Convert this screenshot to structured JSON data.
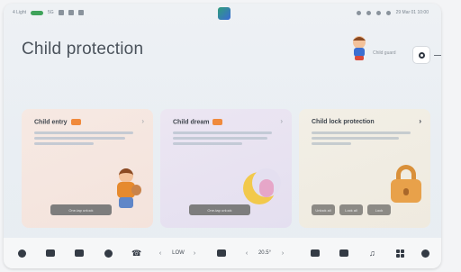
{
  "status_bar": {
    "left_text": "4 Light",
    "signal_text": "5G",
    "right_text": "29 Mar 01 10:00"
  },
  "header": {
    "title": "Child protection",
    "profile_label": "Child guard"
  },
  "cards": {
    "child_entry": {
      "title": "Child entry",
      "chevron": "›",
      "action_label": "One-tap unlock"
    },
    "child_dream": {
      "title": "Child dream",
      "chevron": "›",
      "action_label": "One-tap unlock"
    },
    "child_lock": {
      "title": "Child lock protection",
      "chevron": "›",
      "actions": [
        "Unlock all",
        "Lock all",
        "Lock"
      ]
    }
  },
  "dock": {
    "fan_level": "LOW",
    "temperature": "20.5°",
    "left_chevron": "‹",
    "right_chevron": "›"
  },
  "colors": {
    "accent_orange": "#f08a3c",
    "title_text": "#4a525b",
    "card_entry_bg": "#f6e9e3",
    "card_dream_bg": "#ece6f2",
    "card_lock_bg": "#f2efe6",
    "button_gray": "#7d7d7d"
  },
  "icons": {
    "settings": "gear-icon",
    "dock": [
      "car-icon",
      "seat-icon",
      "window-icon",
      "fan-icon",
      "phone-icon",
      "climate-icon",
      "wiper-icon",
      "media-icon",
      "music-icon",
      "apps-icon",
      "volume-icon"
    ]
  }
}
